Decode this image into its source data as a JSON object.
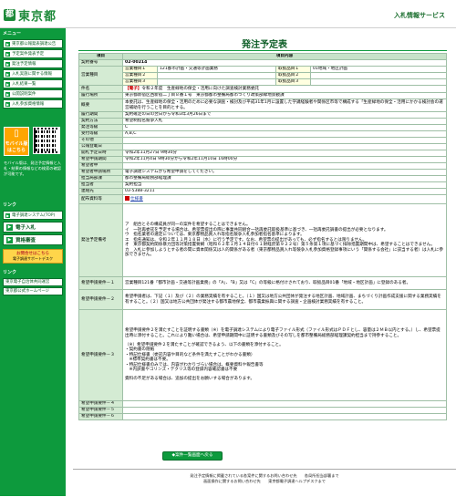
{
  "header": {
    "logo_mark": "都",
    "logo_text": "東京都",
    "service_title": "入札情報サービス"
  },
  "sidebar": {
    "section1_label": "メニュー",
    "items": [
      {
        "label": "東京都公報発表調達公告"
      },
      {
        "label": "予定案件発表予定"
      },
      {
        "label": "発注予定情報"
      },
      {
        "label": "入札実施に関する情報"
      },
      {
        "label": "入札結果一覧"
      },
      {
        "label": "公開説明案件"
      },
      {
        "label": "入札参加資格情報"
      }
    ],
    "mobile_label": "モバイル版",
    "mobile_sub": "はこちら",
    "mobile_desc": "モバイル版は、発注予定情報と入札・結果の情報などの検索の確認が可能です。",
    "section2_label": "リンク",
    "links": [
      {
        "label": "電子調達システム(TOP)"
      },
      {
        "label": "電子入札"
      },
      {
        "label": "資格審査"
      }
    ],
    "pdf_title": "お問合せはこちら",
    "pdf_sub": "電子調達サポートデスク",
    "section3_label": "リンク",
    "footer_links": [
      {
        "label": "東京電子自治体共同運営"
      },
      {
        "label": "東京都公式ホームページ"
      }
    ]
  },
  "main": {
    "page_title": "発注予定表",
    "col_item": "項目",
    "col_content": "項目内容",
    "contract_no_label": "契約番号",
    "contract_no": "02-00214",
    "business_type_label": "営業種目",
    "business_rows": [
      {
        "sub": "営業種目１",
        "val": "121都市計画・交通等計画業務",
        "sub2": "取扱品目１",
        "val2": "01地域・地区計画"
      },
      {
        "sub": "営業種目２",
        "val": "",
        "sub2": "取扱品目２",
        "val2": ""
      },
      {
        "sub": "営業種目３",
        "val": "",
        "sub2": "取扱品目３",
        "val2": ""
      }
    ],
    "subject_label": "件名",
    "subject_tag": "【電子】",
    "subject": "令和２年度　生産緑地の保全・活用に向けた調査検討業務委託",
    "place_label": "履行場所",
    "place": "東京都新宿区西新宿二丁目８番１号　東京都都市整備局都市づくり政策部緑地景観課",
    "summary_label": "概要",
    "summary": "本委託は、生産緑地の保全・活用のために必要な調査・検討及び平成31年1月に設置した学識経験者や関係区市等で構成する「生産緑地の保全・活用にかかる検討会の運営補助を行うことを目的とする。",
    "period_label": "履行期間",
    "period": "契約確定の日の翌日から令和3年3月26日まで",
    "method_label": "契約方法",
    "method": "希望制指名競争入札",
    "rank_label": "発注等級",
    "rank": "C",
    "accept_label": "受付等級",
    "accept": "A,B,C",
    "other_label": "その他",
    "other": "",
    "notice_label": "公報登載日",
    "notice": "",
    "open_label": "開札予定日時",
    "open": "令和2年11月27日 9時30分",
    "apply_label": "希望申請期間",
    "apply": "令和2年11月4日 9時30分から令和2年11月10日 16時00分",
    "place2_label": "希望者申",
    "place2": "",
    "method2_label": "希望者申請場所",
    "method2": "電子調達システムから希望申請をしてください。",
    "dept_label": "担当局部課",
    "dept": "都市整備局総務部経理課",
    "person_label": "担当者",
    "person": "契約担当",
    "tel_label": "連絡先",
    "tel": "03-5388-3211",
    "docs_label": "配布資料等",
    "docs_link": "仕様書",
    "notes_label": "発注予定備考",
    "notes": [
      "ア　組合とその構成員が同一の案件を希望することはできません。",
      "イ　一括再委託を予定する場合は、希望票提出の際に事業共同組合一括再委託取扱基準に基づき、一括再委託調書の提出が必要となります。",
      "ウ　指名業者の選定については、東京都物品買入れ等指名競争入札参加者指名基準によります。",
      "エ　指名通知は、令和２年１１月１８日（水）に行う予定です。なお、希望票の提出があっても、必ず指名するとは限りません。",
      "オ　東京都契約関係暴力団等対策措置要綱（昭和６２年１月１４日付６１財経庶第９２２号）第５条第１項に基づく排除措置期間中は、希望することはできません。",
      "カ　入札に参加しようとする者の間に資本関係又は人的関係がある者（東京都物品買入れ等競争入札参加資格登録事項にいう「関係する会社」に該当する者）は入札に参加できません。"
    ],
    "req1_label": "希望申請要件－１",
    "req1": "営業種目121番「都市計画・交通等計画業務」の「A」、「B」又は「C」の等級に格付けされており、取扱品目01番「地域・地区計画」に登録のある者。",
    "req2_label": "希望申請要件－２",
    "req2": "希望申請者は、下記（１）及び（２）の業務実績を有すること。（１）国又は地方公共団体が発注する地区計画、地域計画、まちづくり計画作成支援に関する業務実績を有すること。（２）国又は地方公共団体が発注する都市農地保全、都市農業振興に関する調査・企画検討業務実績を有すること。",
    "req3_label": "希望申請要件－３",
    "req3": [
      "希望申請要件２を満たすことを証明する書類（※）を電子調達システムにより電子ファイル形式（ファイル形式はＰＤＦとし、容量は２ＭＢ以内とする。）し、希望票提出時に添付すること。これにより難い場合は、希望申請期間中に証明する書類及びその写しを都市整備局総務部経理課契約担当まで持参すること。",
      "（※）希望申請要件２を満たすことが確認できるよう、以下の書類を添付すること。",
      "・契約書の隠紙",
      "・特記仕様書（委託内容や目的など条件を満たすことがわかる書類）",
      "　※標準契約書は不要。",
      "・特記仕様書のみでは、内容がわかりづらい場合は、概要資料や報告書等",
      "　※内訳書やコリンズ・テクリス等の登録内容確認書は不要",
      "資料の不足がある場合は、追加の提出をお願いする場合があります。"
    ],
    "req4_label": "希望申請要件－４",
    "req5_label": "希望申請要件－５",
    "req6_label": "希望申請要件－６",
    "return_button": "◆案件一覧画面へ戻る"
  },
  "footer": {
    "line1": "発注予定情報に掲載されている各案件に関するお問い合わせ先　　各局所担当部署まで",
    "line2": "画面操作に関するお問い合わせ先　　東京都電子調達ヘルプデスクまで"
  }
}
